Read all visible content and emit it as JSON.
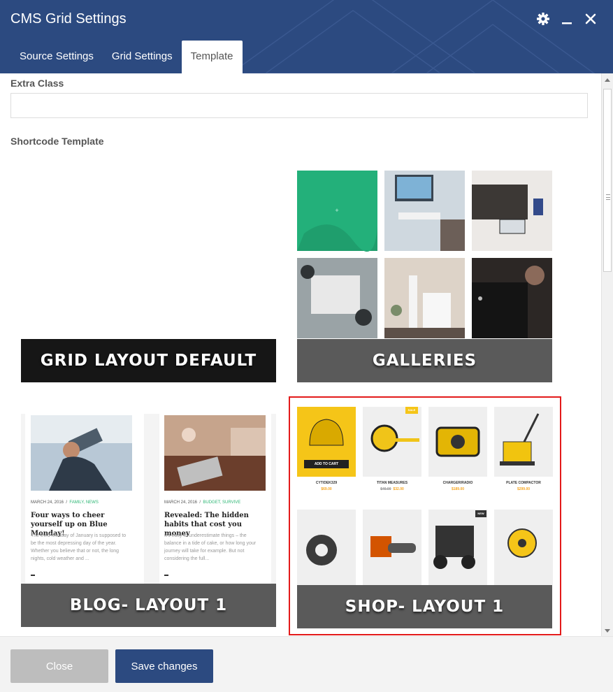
{
  "window": {
    "title": "CMS Grid Settings",
    "icons": [
      "gear-icon",
      "minimize-icon",
      "close-icon"
    ]
  },
  "tabs": [
    {
      "label": "Source Settings",
      "active": false
    },
    {
      "label": "Grid Settings",
      "active": false
    },
    {
      "label": "Template",
      "active": true
    }
  ],
  "form": {
    "extra_class_label": "Extra Class",
    "extra_class_value": "",
    "shortcode_template_label": "Shortcode Template"
  },
  "templates": [
    {
      "name": "GRID LAYOUT DEFAULT",
      "selected": false
    },
    {
      "name": "GALLERIES",
      "selected": false
    },
    {
      "name": "BLOG- LAYOUT 1",
      "selected": false
    },
    {
      "name": "SHOP- LAYOUT 1",
      "selected": true
    }
  ],
  "blog_preview": [
    {
      "date": "MARCH 24, 2016",
      "categories": "FAMILY, NEWS",
      "title": "Four ways to cheer yourself up on Blue Monday!",
      "excerpt": "The third Monday of January is supposed to be the most depressing day of the year. Whether you believe that or not, the long nights, cold weather and ..."
    },
    {
      "date": "MARCH 24, 2016",
      "categories": "BUDGET, SURVIVE",
      "title": "Revealed: The hidden habits that cost you money",
      "excerpt": "It's easy to underestimate things – the balance in a tide of cake, or how long your journey will take for example. But not considering the full..."
    }
  ],
  "shop_preview": {
    "add_to_cart": "ADD TO CART",
    "sale_badge": "SALE",
    "new_badge": "NEW",
    "products": [
      {
        "name": "CYT/DEK329",
        "price": "$69.00",
        "old_price": ""
      },
      {
        "name": "TITAN MEASURES",
        "price": "$32.00",
        "old_price": "$40.00"
      },
      {
        "name": "CHARGER/RADIO",
        "price": "$189.00",
        "old_price": ""
      },
      {
        "name": "PLATE COMPACTOR",
        "price": "$299.00",
        "old_price": ""
      }
    ]
  },
  "colors": {
    "header": "#2c4a80",
    "primary_button": "#2c4a80",
    "close_button": "#bdbdbd",
    "selected_outline": "#e31b1b",
    "shop_accent": "#f5c518"
  },
  "footer": {
    "close_label": "Close",
    "save_label": "Save changes"
  }
}
